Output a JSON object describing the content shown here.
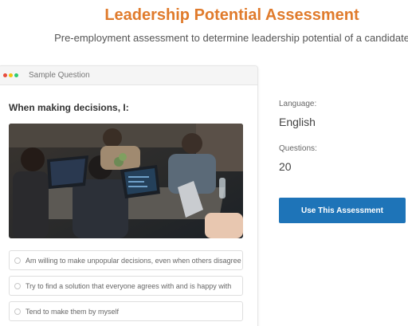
{
  "header": {
    "title": "Leadership Potential Assessment",
    "subtitle": "Pre-employment assessment to determine leadership potential of a candidate"
  },
  "sample": {
    "label": "Sample Question",
    "window_dots": [
      "#e74c3c",
      "#f1c40f",
      "#2ecc71"
    ],
    "question": "When making decisions, I:",
    "options": [
      "Am willing to make unpopular decisions, even when others disagree",
      "Try to find a solution that everyone agrees with and is happy with",
      "Tend to make them by myself"
    ]
  },
  "details": {
    "language_label": "Language:",
    "language_value": "English",
    "questions_label": "Questions:",
    "questions_value": "20",
    "cta_label": "Use This Assessment"
  },
  "colors": {
    "title": "#e07b2c",
    "cta": "#1e74b8"
  }
}
